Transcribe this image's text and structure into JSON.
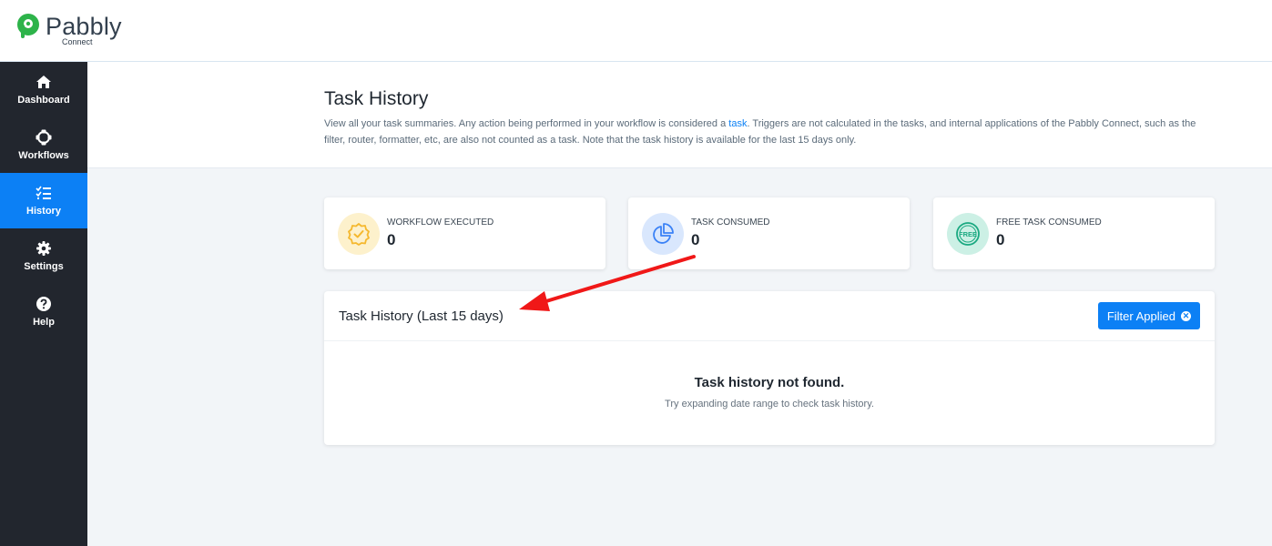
{
  "brand": {
    "name": "Pabbly",
    "subname": "Connect",
    "color": "#2db34a"
  },
  "sidebar": {
    "items": [
      {
        "label": "Dashboard",
        "icon": "home-icon",
        "active": false
      },
      {
        "label": "Workflows",
        "icon": "workflow-icon",
        "active": false
      },
      {
        "label": "History",
        "icon": "list-check-icon",
        "active": true
      },
      {
        "label": "Settings",
        "icon": "gear-icon",
        "active": false
      },
      {
        "label": "Help",
        "icon": "question-circle-icon",
        "active": false
      }
    ],
    "active_color": "#0c80f5"
  },
  "header": {
    "title": "Task History",
    "description_before": "View all your task summaries. Any action being performed in your workflow is considered a ",
    "description_link": "task",
    "description_after": ". Triggers are not calculated in the tasks, and internal applications of the Pabbly Connect, such as the filter, router, formatter, etc, are also not counted as a task. Note that the task history is available for the last 15 days only."
  },
  "stats": [
    {
      "label": "WORKFLOW EXECUTED",
      "value": "0",
      "icon": "badge-check-icon",
      "color": "#f5b82e"
    },
    {
      "label": "TASK CONSUMED",
      "value": "0",
      "icon": "pie-chart-icon",
      "color": "#3b82f6"
    },
    {
      "label": "FREE TASK CONSUMED",
      "value": "0",
      "icon": "free-badge-icon",
      "color": "#1aa981"
    }
  ],
  "history": {
    "title": "Task History (Last 15 days)",
    "filter_button": "Filter Applied",
    "empty_title": "Task history not found.",
    "empty_subtitle": "Try expanding date range to check task history."
  },
  "annotation": {
    "arrow_color": "#f01818"
  }
}
